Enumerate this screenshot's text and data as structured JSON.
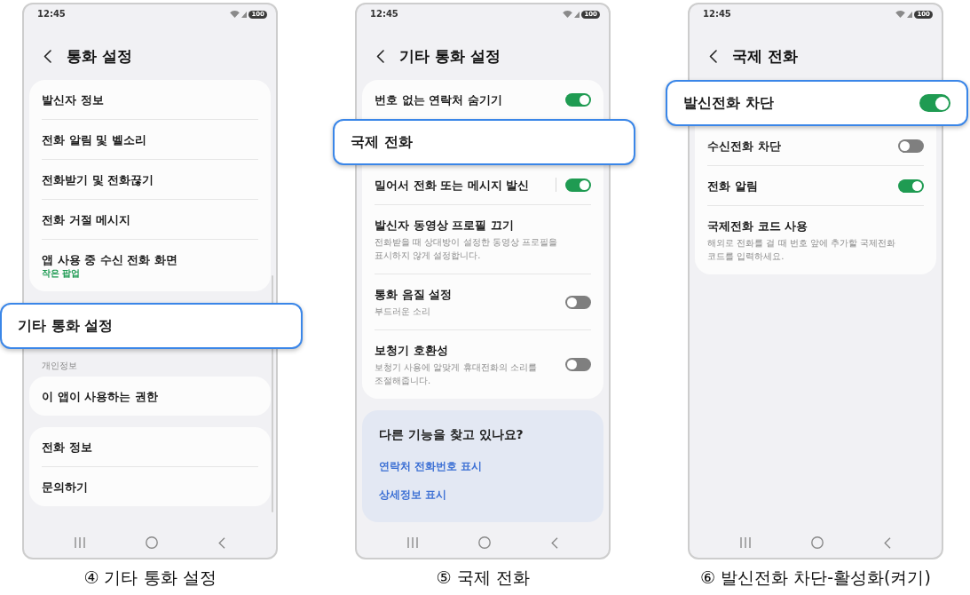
{
  "panels": [
    {
      "status_bar": {
        "time": "12:45",
        "battery": "100"
      },
      "header": {
        "title": "통화 설정"
      },
      "scrollbar": true,
      "groups": [
        {
          "kind": "card",
          "rows": [
            {
              "kind": "nav",
              "title": "발신자 정보",
              "highlighted": false
            },
            {
              "kind": "nav",
              "title": "전화 알림 및 벨소리",
              "highlighted": false
            },
            {
              "kind": "nav",
              "title": "전화받기 및 전화끊기",
              "highlighted": false
            },
            {
              "kind": "nav",
              "title": "전화 거절 메시지",
              "highlighted": false
            },
            {
              "kind": "nav",
              "title": "앱 사용 중 수신 전화 화면",
              "value": "작은 팝업",
              "highlighted": false
            }
          ]
        },
        {
          "kind": "card",
          "rows": [
            {
              "kind": "nav",
              "title": "기타 통화 설정",
              "highlighted": true
            }
          ]
        },
        {
          "kind": "card",
          "heading": "개인정보",
          "rows": [
            {
              "kind": "nav",
              "title": "이 앱이 사용하는 권한",
              "highlighted": false
            }
          ]
        },
        {
          "kind": "card",
          "rows": [
            {
              "kind": "nav",
              "title": "전화 정보",
              "highlighted": false
            },
            {
              "kind": "nav",
              "title": "문의하기",
              "highlighted": false
            }
          ]
        }
      ],
      "caption": "④ 기타 통화 설정"
    },
    {
      "status_bar": {
        "time": "12:45",
        "battery": "100"
      },
      "header": {
        "title": "기타 통화 설정"
      },
      "groups": [
        {
          "kind": "card",
          "rows": [
            {
              "kind": "toggle",
              "title": "번호 없는 연락처 숨기기",
              "on": true,
              "highlighted": false
            },
            {
              "kind": "nav",
              "title": "국제 전화",
              "highlighted": true
            },
            {
              "kind": "toggle_split",
              "title": "밀어서 전화 또는 메시지 발신",
              "on": true,
              "highlighted": false
            },
            {
              "kind": "nav",
              "title": "발신자 동영상 프로필 끄기",
              "description": "전화받을 때 상대방이 설정한 동영상 프로필을 표시하지 않게 설정합니다.",
              "highlighted": false
            },
            {
              "kind": "toggle",
              "title": "통화 음질 설정",
              "description": "부드러운 소리",
              "on": false,
              "highlighted": false
            },
            {
              "kind": "toggle",
              "title": "보청기 호환성",
              "description": "보청기 사용에 알맞게 휴대전화의 소리를 조절해줍니다.",
              "on": false,
              "highlighted": false
            }
          ]
        },
        {
          "kind": "suggestions",
          "title": "다른 기능을 찾고 있나요?",
          "links": [
            "연락처 전화번호 표시",
            "상세정보 표시"
          ]
        }
      ],
      "caption": "⑤ 국제 전화"
    },
    {
      "status_bar": {
        "time": "12:45",
        "battery": "100"
      },
      "header": {
        "title": "국제 전화"
      },
      "groups": [
        {
          "kind": "card",
          "rows": [
            {
              "kind": "toggle",
              "title": "발신전화 차단",
              "on": true,
              "highlighted": true
            },
            {
              "kind": "toggle",
              "title": "수신전화 차단",
              "on": false,
              "highlighted": false
            },
            {
              "kind": "toggle",
              "title": "전화 알림",
              "on": true,
              "highlighted": false
            },
            {
              "kind": "nav",
              "title": "국제전화 코드 사용",
              "description": "해외로 전화를 걸 때 번호 앞에 추가할 국제전화 코드를 입력하세요.",
              "highlighted": false
            }
          ]
        }
      ],
      "caption": "⑥ 발신전화 차단-활성화(켜기)"
    }
  ]
}
